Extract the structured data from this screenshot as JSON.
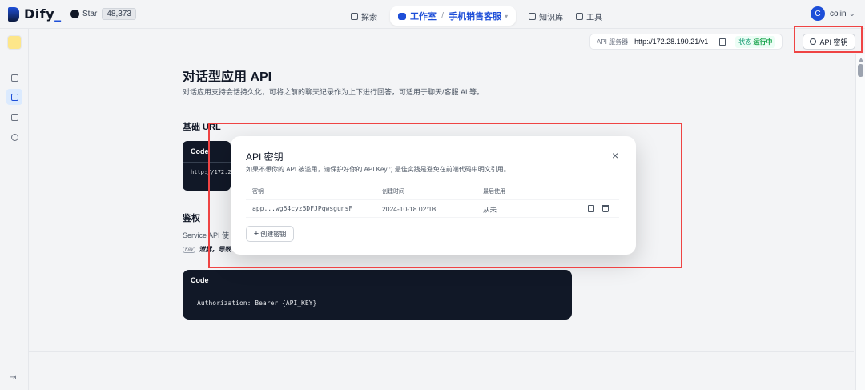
{
  "brand": {
    "name": "Dify",
    "underscore": "_"
  },
  "github": {
    "label": "Star",
    "count": "48,373"
  },
  "nav": {
    "explore": "探索",
    "studio": "工作室",
    "separator": "/",
    "app_name": "手机销售客服",
    "knowledge": "知识库",
    "tools": "工具"
  },
  "user": {
    "initial": "C",
    "name": "colin",
    "chevron": "⌄"
  },
  "server": {
    "label": "API 服务器",
    "url": "http://172.28.190.21/v1",
    "status_label": "状态",
    "status_value": "运行中",
    "api_button": "API 密钥"
  },
  "doc": {
    "title": "对话型应用 API",
    "description": "对话应用支持会话持久化，可将之前的聊天记录作为上下进行回答，可适用于聊天/客服 AI 等。",
    "base_url_heading": "基础 URL",
    "code_label": "Code",
    "base_url_code": "http://172.2",
    "auth_heading": "鉴权",
    "auth_text": "Service API 使",
    "auth_key_tag": "Key",
    "auth_warn": "泄露，导致",
    "auth_code": "Authorization: Bearer {API_KEY}"
  },
  "modal": {
    "title": "API 密钥",
    "close": "×",
    "description": "如果不想你的 API 被滥用，请保护好你的 API Key :) 最佳实践是避免在前端代码中明文引用。",
    "columns": {
      "key": "密钥",
      "created": "创建时间",
      "last_used": "最后使用"
    },
    "rows": [
      {
        "key": "app...wg64cyz5DFJPqwsgunsF",
        "created": "2024-10-18 02:18",
        "last_used": "从未"
      }
    ],
    "create_button": "创建密钥",
    "create_plus": "+"
  },
  "sidebar": {
    "collapse": "⇥"
  },
  "colors": {
    "accent": "#1d4ed8",
    "highlight": "#ef4444",
    "status": "#16a34a"
  }
}
